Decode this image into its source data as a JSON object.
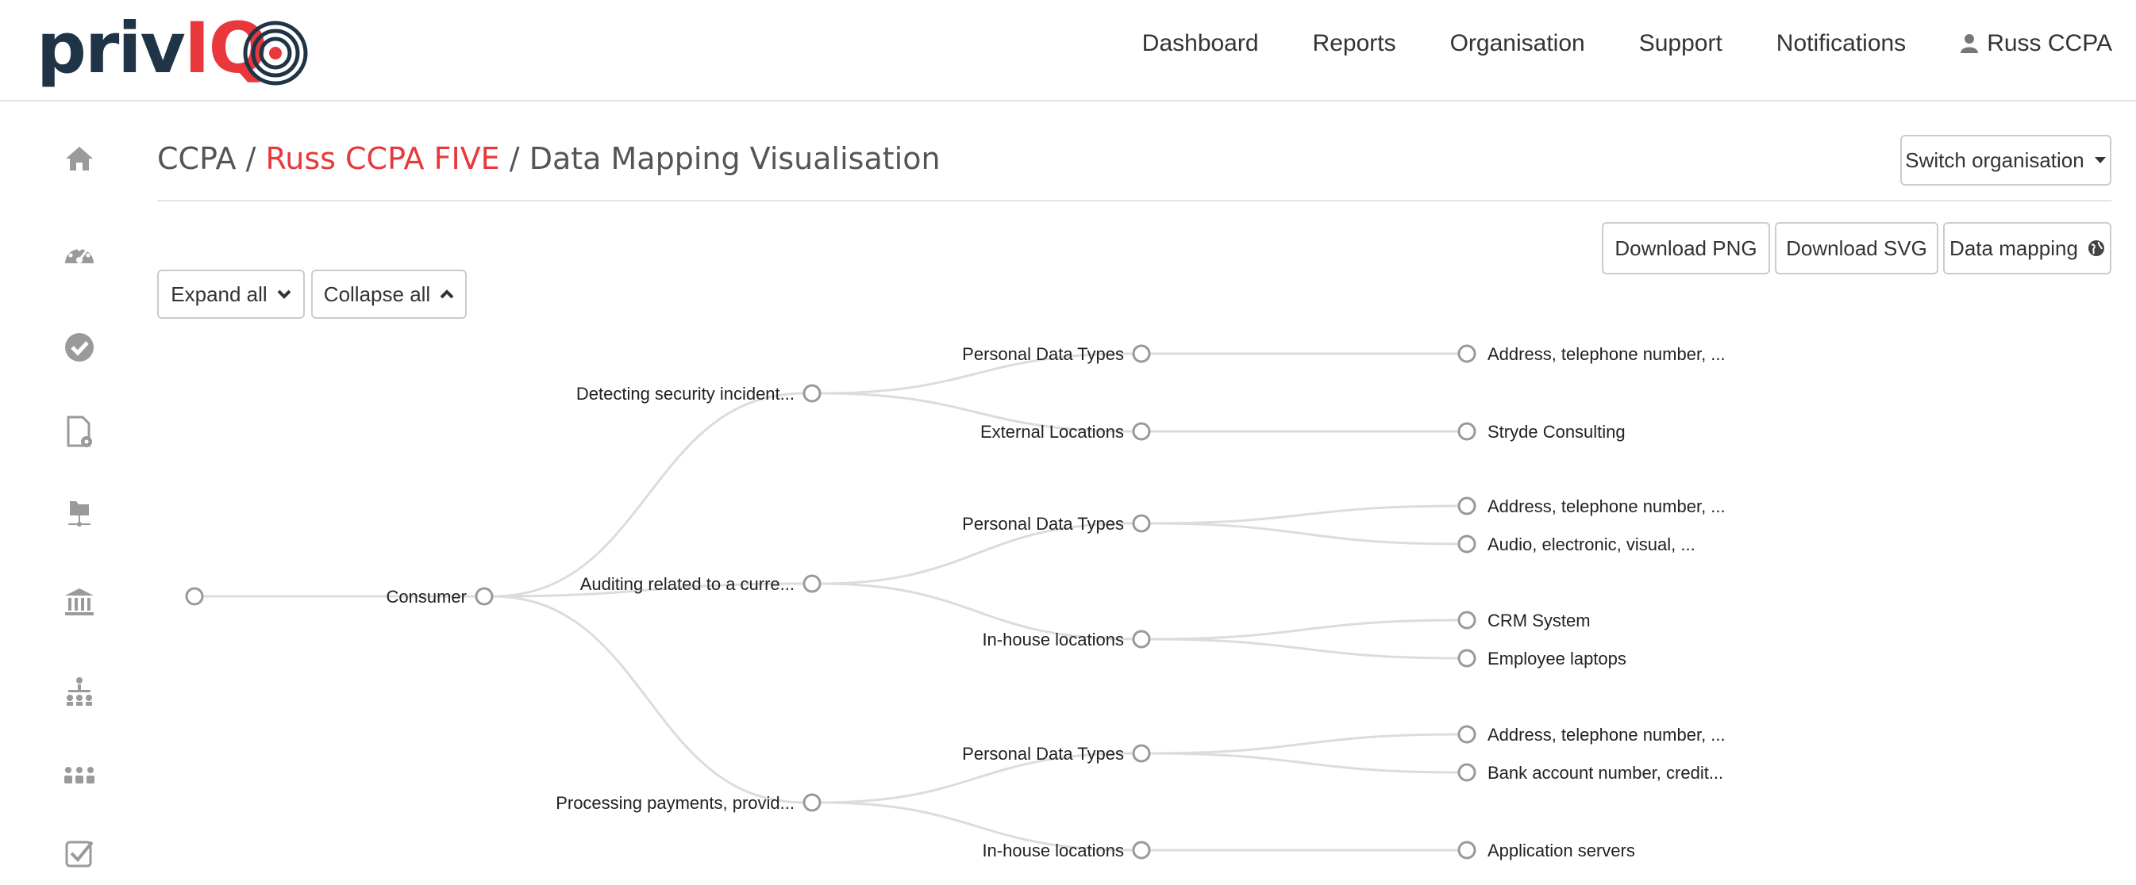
{
  "brand": {
    "logo_part1": "priv",
    "logo_part2": "IQ"
  },
  "nav": {
    "items": [
      "Dashboard",
      "Reports",
      "Organisation",
      "Support",
      "Notifications"
    ],
    "user": "Russ CCPA"
  },
  "breadcrumb": {
    "root": "CCPA",
    "separator": "/",
    "organisation": "Russ CCPA FIVE",
    "page": "Data Mapping Visualisation"
  },
  "toolbar": {
    "switch_org": "Switch organisation",
    "download_png": "Download PNG",
    "download_svg": "Download SVG",
    "data_mapping": "Data mapping",
    "expand_all": "Expand all",
    "collapse_all": "Collapse all"
  },
  "sidebar": {
    "icons": [
      "home-icon",
      "dashboard-gauge-icon",
      "check-circle-icon",
      "document-settings-icon",
      "folder-network-icon",
      "bank-icon",
      "hierarchy-icon",
      "users-icon",
      "checkbox-icon"
    ]
  },
  "colors": {
    "accent": "#e8383b",
    "brand_dark": "#1f3446",
    "link_line": "#dcdcdc",
    "node_stroke": "#999999"
  },
  "tree": {
    "root": {
      "label": ""
    },
    "level1": "Consumer",
    "purposes": [
      {
        "label": "Detecting security incident...",
        "groups": [
          {
            "label": "Personal Data Types",
            "items": [
              "Address, telephone number, ..."
            ]
          },
          {
            "label": "External Locations",
            "items": [
              "Stryde Consulting"
            ]
          }
        ]
      },
      {
        "label": "Auditing related to a curre...",
        "groups": [
          {
            "label": "Personal Data Types",
            "items": [
              "Address, telephone number, ...",
              "Audio, electronic, visual, ..."
            ]
          },
          {
            "label": "In-house locations",
            "items": [
              "CRM System",
              "Employee laptops"
            ]
          }
        ]
      },
      {
        "label": "Processing payments, provid...",
        "groups": [
          {
            "label": "Personal Data Types",
            "items": [
              "Address, telephone number, ...",
              "Bank account number, credit..."
            ]
          },
          {
            "label": "In-house locations",
            "items": [
              "Application servers"
            ]
          }
        ]
      }
    ]
  }
}
